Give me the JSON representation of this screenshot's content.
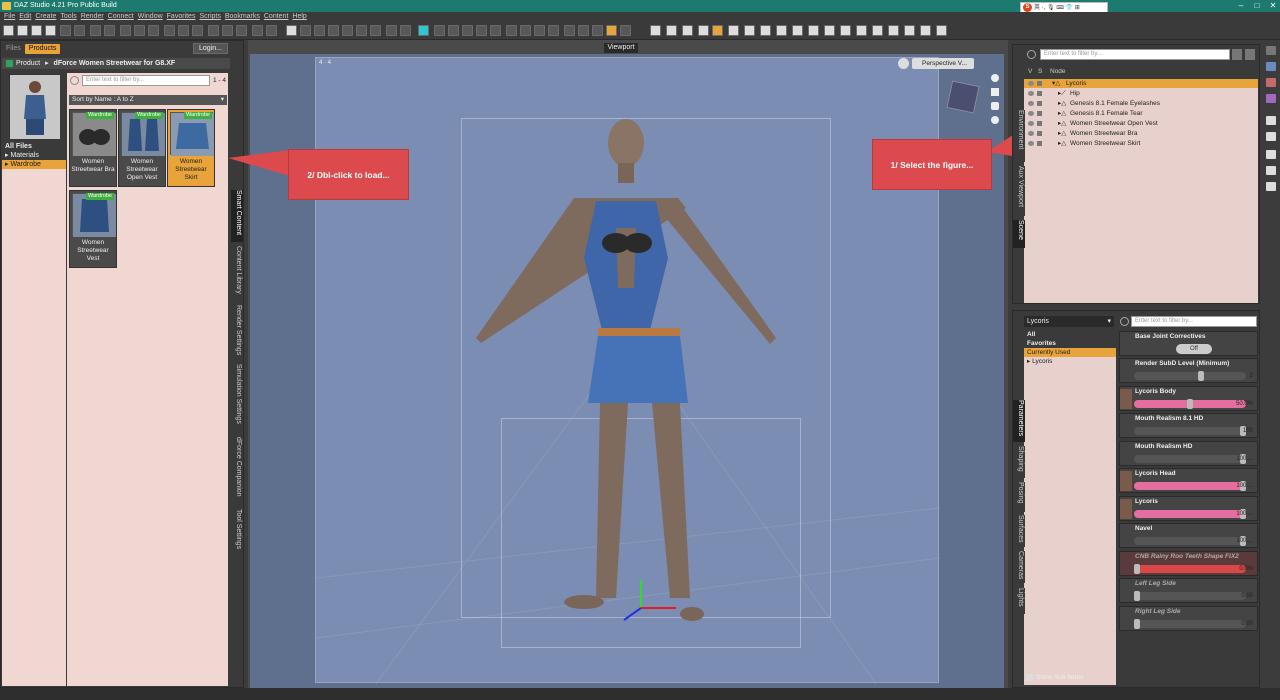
{
  "window": {
    "title": "DAZ Studio 4.21 Pro Public Build",
    "controls": [
      "–",
      "□",
      "✕"
    ]
  },
  "ime": {
    "logo": "S",
    "text": "英 ·, 🎙 ⌨ 👕 ⊞"
  },
  "menu": [
    "File",
    "Edit",
    "Create",
    "Tools",
    "Render",
    "Connect",
    "Window",
    "Favorites",
    "Scripts",
    "Bookmarks",
    "Content",
    "Help"
  ],
  "left_panel": {
    "tabs": [
      "Files",
      "Products"
    ],
    "active_tab": "Products",
    "login_label": "Login...",
    "breadcrumb_root": "Product",
    "product_name": "dForce Women Streetwear for G8.XF",
    "filter_placeholder": "Enter text to filter by...",
    "count": "1 - 4",
    "sort_label": "Sort by Name : A to Z",
    "tree": [
      {
        "label": "All Files",
        "type": "header"
      },
      {
        "label": "▸ Materials",
        "type": "item"
      },
      {
        "label": "▸ Wardrobe",
        "type": "selected"
      }
    ],
    "cards": [
      {
        "badge": "Wardrobe",
        "label": "Women Streetwear Bra",
        "selected": false
      },
      {
        "badge": "Wardrobe",
        "label": "Women Streetwear Open Vest",
        "selected": false
      },
      {
        "badge": "Wardrobe",
        "label": "Women Streetwear Skirt",
        "selected": true
      },
      {
        "badge": "Wardrobe",
        "label": "Women Streetwear Vest",
        "selected": false
      }
    ],
    "side_tabs": [
      "Smart Content",
      "Content Library",
      "Render Settings",
      "Simulation Settings",
      "dForce Companion",
      "Tool Settings"
    ]
  },
  "viewport": {
    "tab_label": "Viewport",
    "camera_label": "Perspective V...",
    "corner_label": "4 · 4"
  },
  "callouts": {
    "load": "2/ Dbl-click to load...",
    "select": "1/ Select the figure..."
  },
  "scene": {
    "filter_placeholder": "Enter text to filter by...",
    "columns": [
      "V",
      "S",
      "Node"
    ],
    "rows": [
      {
        "label": "Lycoris",
        "indent": 1,
        "selected": true
      },
      {
        "label": "Hip",
        "indent": 2,
        "selected": false
      },
      {
        "label": "Genesis 8.1 Female Eyelashes",
        "indent": 2,
        "selected": false
      },
      {
        "label": "Genesis 8.1 Female Tear",
        "indent": 2,
        "selected": false
      },
      {
        "label": "Women Streetwear Open Vest",
        "indent": 2,
        "selected": false
      },
      {
        "label": "Women Streetwear Bra",
        "indent": 2,
        "selected": false
      },
      {
        "label": "Women Streetwear Skirt",
        "indent": 2,
        "selected": false
      }
    ],
    "side_tabs": [
      "Environment",
      "Aux Viewport",
      "Scene"
    ]
  },
  "parameters": {
    "figure": "Lycoris",
    "filter_placeholder": "Enter text to filter by...",
    "groups": [
      {
        "label": "All",
        "type": "header"
      },
      {
        "label": "Favorites",
        "type": "header"
      },
      {
        "label": "Currently Used",
        "type": "selected"
      },
      {
        "label": "▸ Lycoris",
        "type": "item"
      }
    ],
    "items": [
      {
        "name": "Base Joint Correctives",
        "value": "Off",
        "style": "toggle",
        "level": 0.5
      },
      {
        "name": "Render SubD Level (Minimum)",
        "value": "2",
        "style": "normal",
        "level": 0.6
      },
      {
        "name": "Lycoris Body",
        "value": "50.0%",
        "style": "pink",
        "level": 0.5
      },
      {
        "name": "Mouth Realism 8.1 HD",
        "value": "100",
        "style": "normal",
        "level": 1.0
      },
      {
        "name": "Mouth Realism HD",
        "value": "100....",
        "style": "normal",
        "level": 1.0
      },
      {
        "name": "Lycoris Head",
        "value": "100....",
        "style": "pink",
        "level": 1.0
      },
      {
        "name": "Lycoris",
        "value": "100....",
        "style": "pink",
        "level": 1.0
      },
      {
        "name": "Navel",
        "value": "100....",
        "style": "normal",
        "level": 1.0
      },
      {
        "name": "CNB Rainy Roo Teeth Shape FIX2",
        "value": "0.0%",
        "style": "gray-red",
        "level": 0.0
      },
      {
        "name": "Left Leg Side",
        "value": "0.00",
        "style": "gray",
        "level": 0.0
      },
      {
        "name": "Right Leg Side",
        "value": "0.00",
        "style": "gray",
        "level": 0.0
      }
    ],
    "show_sub_items": "Show Sub Items",
    "side_tabs": [
      "Parameters",
      "Shaping",
      "Posing",
      "Surfaces",
      "Cameras",
      "Lights"
    ]
  },
  "colors": {
    "accent": "#e8a33a",
    "callout": "#dc4a4e",
    "titlebar": "#1d7a6e",
    "wardrobe_badge": "#3fae3f"
  }
}
